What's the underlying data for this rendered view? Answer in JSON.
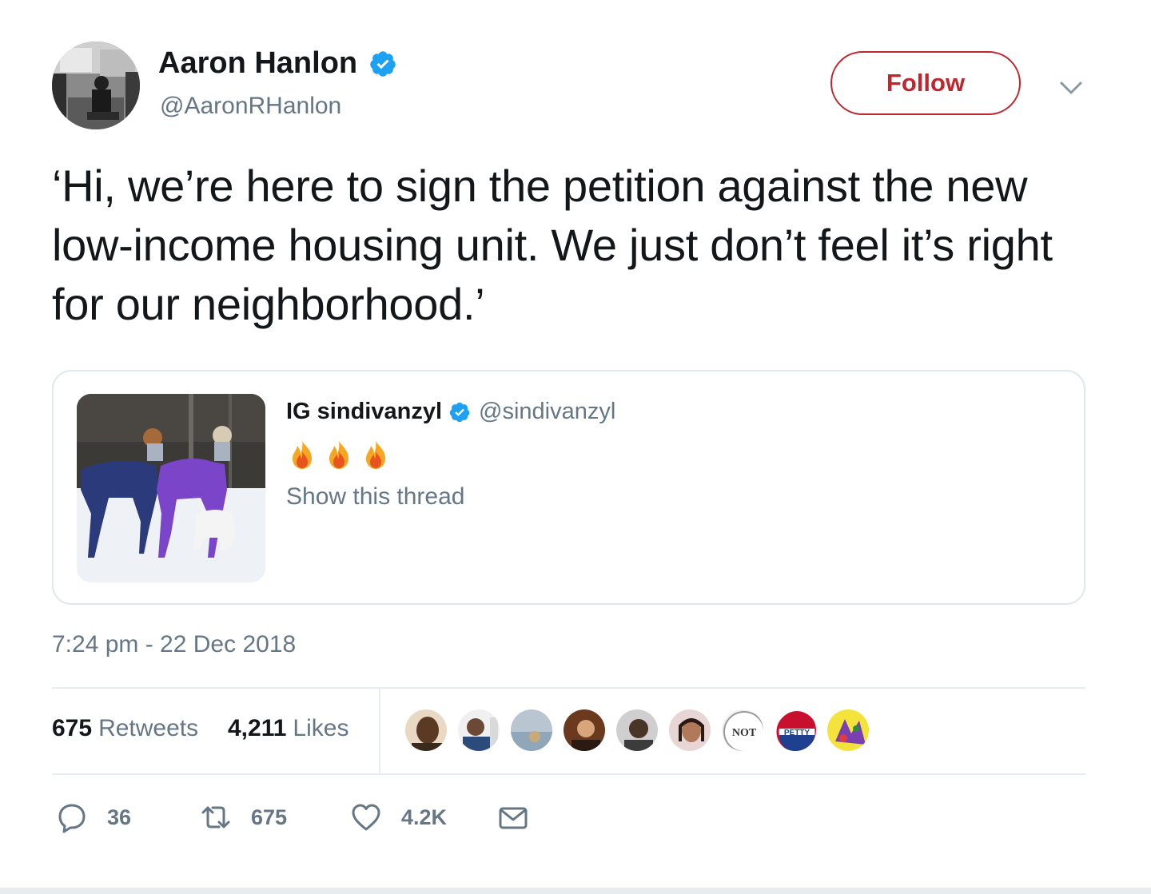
{
  "author": {
    "name": "Aaron Hanlon",
    "handle": "@AaronRHanlon",
    "verified": true
  },
  "follow_button": {
    "label": "Follow",
    "color": "#c0262d"
  },
  "tweet": {
    "text": "‘Hi, we’re here to sign the petition against the new low-income housing unit. We just don’t feel it’s right for our neighborhood.’",
    "timestamp": "7:24 pm - 22 Dec 2018"
  },
  "quoted_tweet": {
    "name": "IG sindivanzyl",
    "handle": "@sindivanzyl",
    "verified": true,
    "emoji": [
      "fire-icon",
      "fire-icon",
      "fire-icon"
    ],
    "show_thread_label": "Show this thread"
  },
  "stats": {
    "retweets_count": "675",
    "retweets_label": "Retweets",
    "likes_count": "4,211",
    "likes_label": "Likes"
  },
  "likers": [
    {
      "name": "liker-1"
    },
    {
      "name": "liker-2"
    },
    {
      "name": "liker-3"
    },
    {
      "name": "liker-4"
    },
    {
      "name": "liker-5"
    },
    {
      "name": "liker-6"
    },
    {
      "name": "liker-7",
      "badge_text": "NOT"
    },
    {
      "name": "liker-8",
      "badge_text": "PETTY"
    },
    {
      "name": "liker-9"
    }
  ],
  "actions": {
    "reply_count": "36",
    "retweet_count": "675",
    "like_count": "4.2K"
  },
  "colors": {
    "verified_blue": "#1da1f2",
    "secondary_text": "#657786",
    "primary_text": "#14171a",
    "border": "#e1e8ed"
  }
}
